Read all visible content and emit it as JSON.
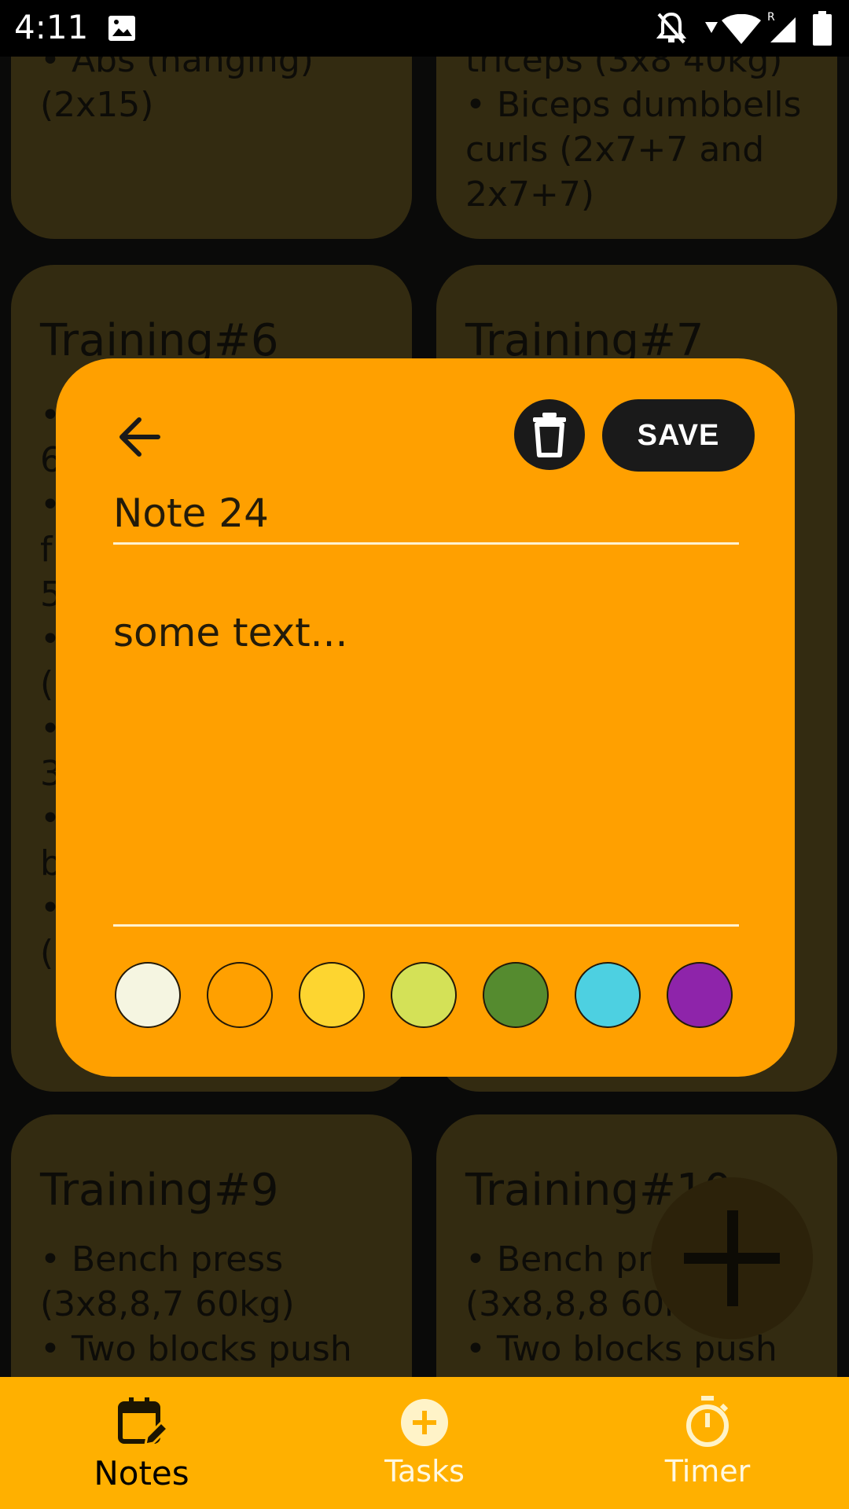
{
  "status_bar": {
    "time": "4:11"
  },
  "cards": [
    {
      "title": "",
      "body": "• Abs (hanging)\n(2x15)"
    },
    {
      "title": "",
      "body": "triceps (3x8 40kg)\n• Biceps dumbbells\ncurls (2x7+7 and\n2x7+7)"
    },
    {
      "title": "Training#6",
      "body": "•\n6\n•\nf\n5\n•\n(\n•\n3\n•\nb\n•\n("
    },
    {
      "title": "Training#7",
      "body": ""
    },
    {
      "title": "Training#9",
      "body": "• Bench press\n(3x8,8,7 60kg)\n• Two blocks push"
    },
    {
      "title": "Training#10",
      "body": "• Bench press\n(3x8,8,8 60kg)\n• Two blocks push"
    }
  ],
  "editor": {
    "save_label": "SAVE",
    "title_value": "Note 24",
    "text_value": "some text...",
    "colors": [
      "#f5f5e1",
      "#ffa000",
      "#fdd530",
      "#d4e157",
      "#558b2f",
      "#4dd0e1",
      "#8e24aa"
    ]
  },
  "bottom_nav": [
    {
      "label": "Notes",
      "icon": "calendar-edit-icon"
    },
    {
      "label": "Tasks",
      "icon": "plus-circle-icon"
    },
    {
      "label": "Timer",
      "icon": "stopwatch-icon"
    }
  ]
}
